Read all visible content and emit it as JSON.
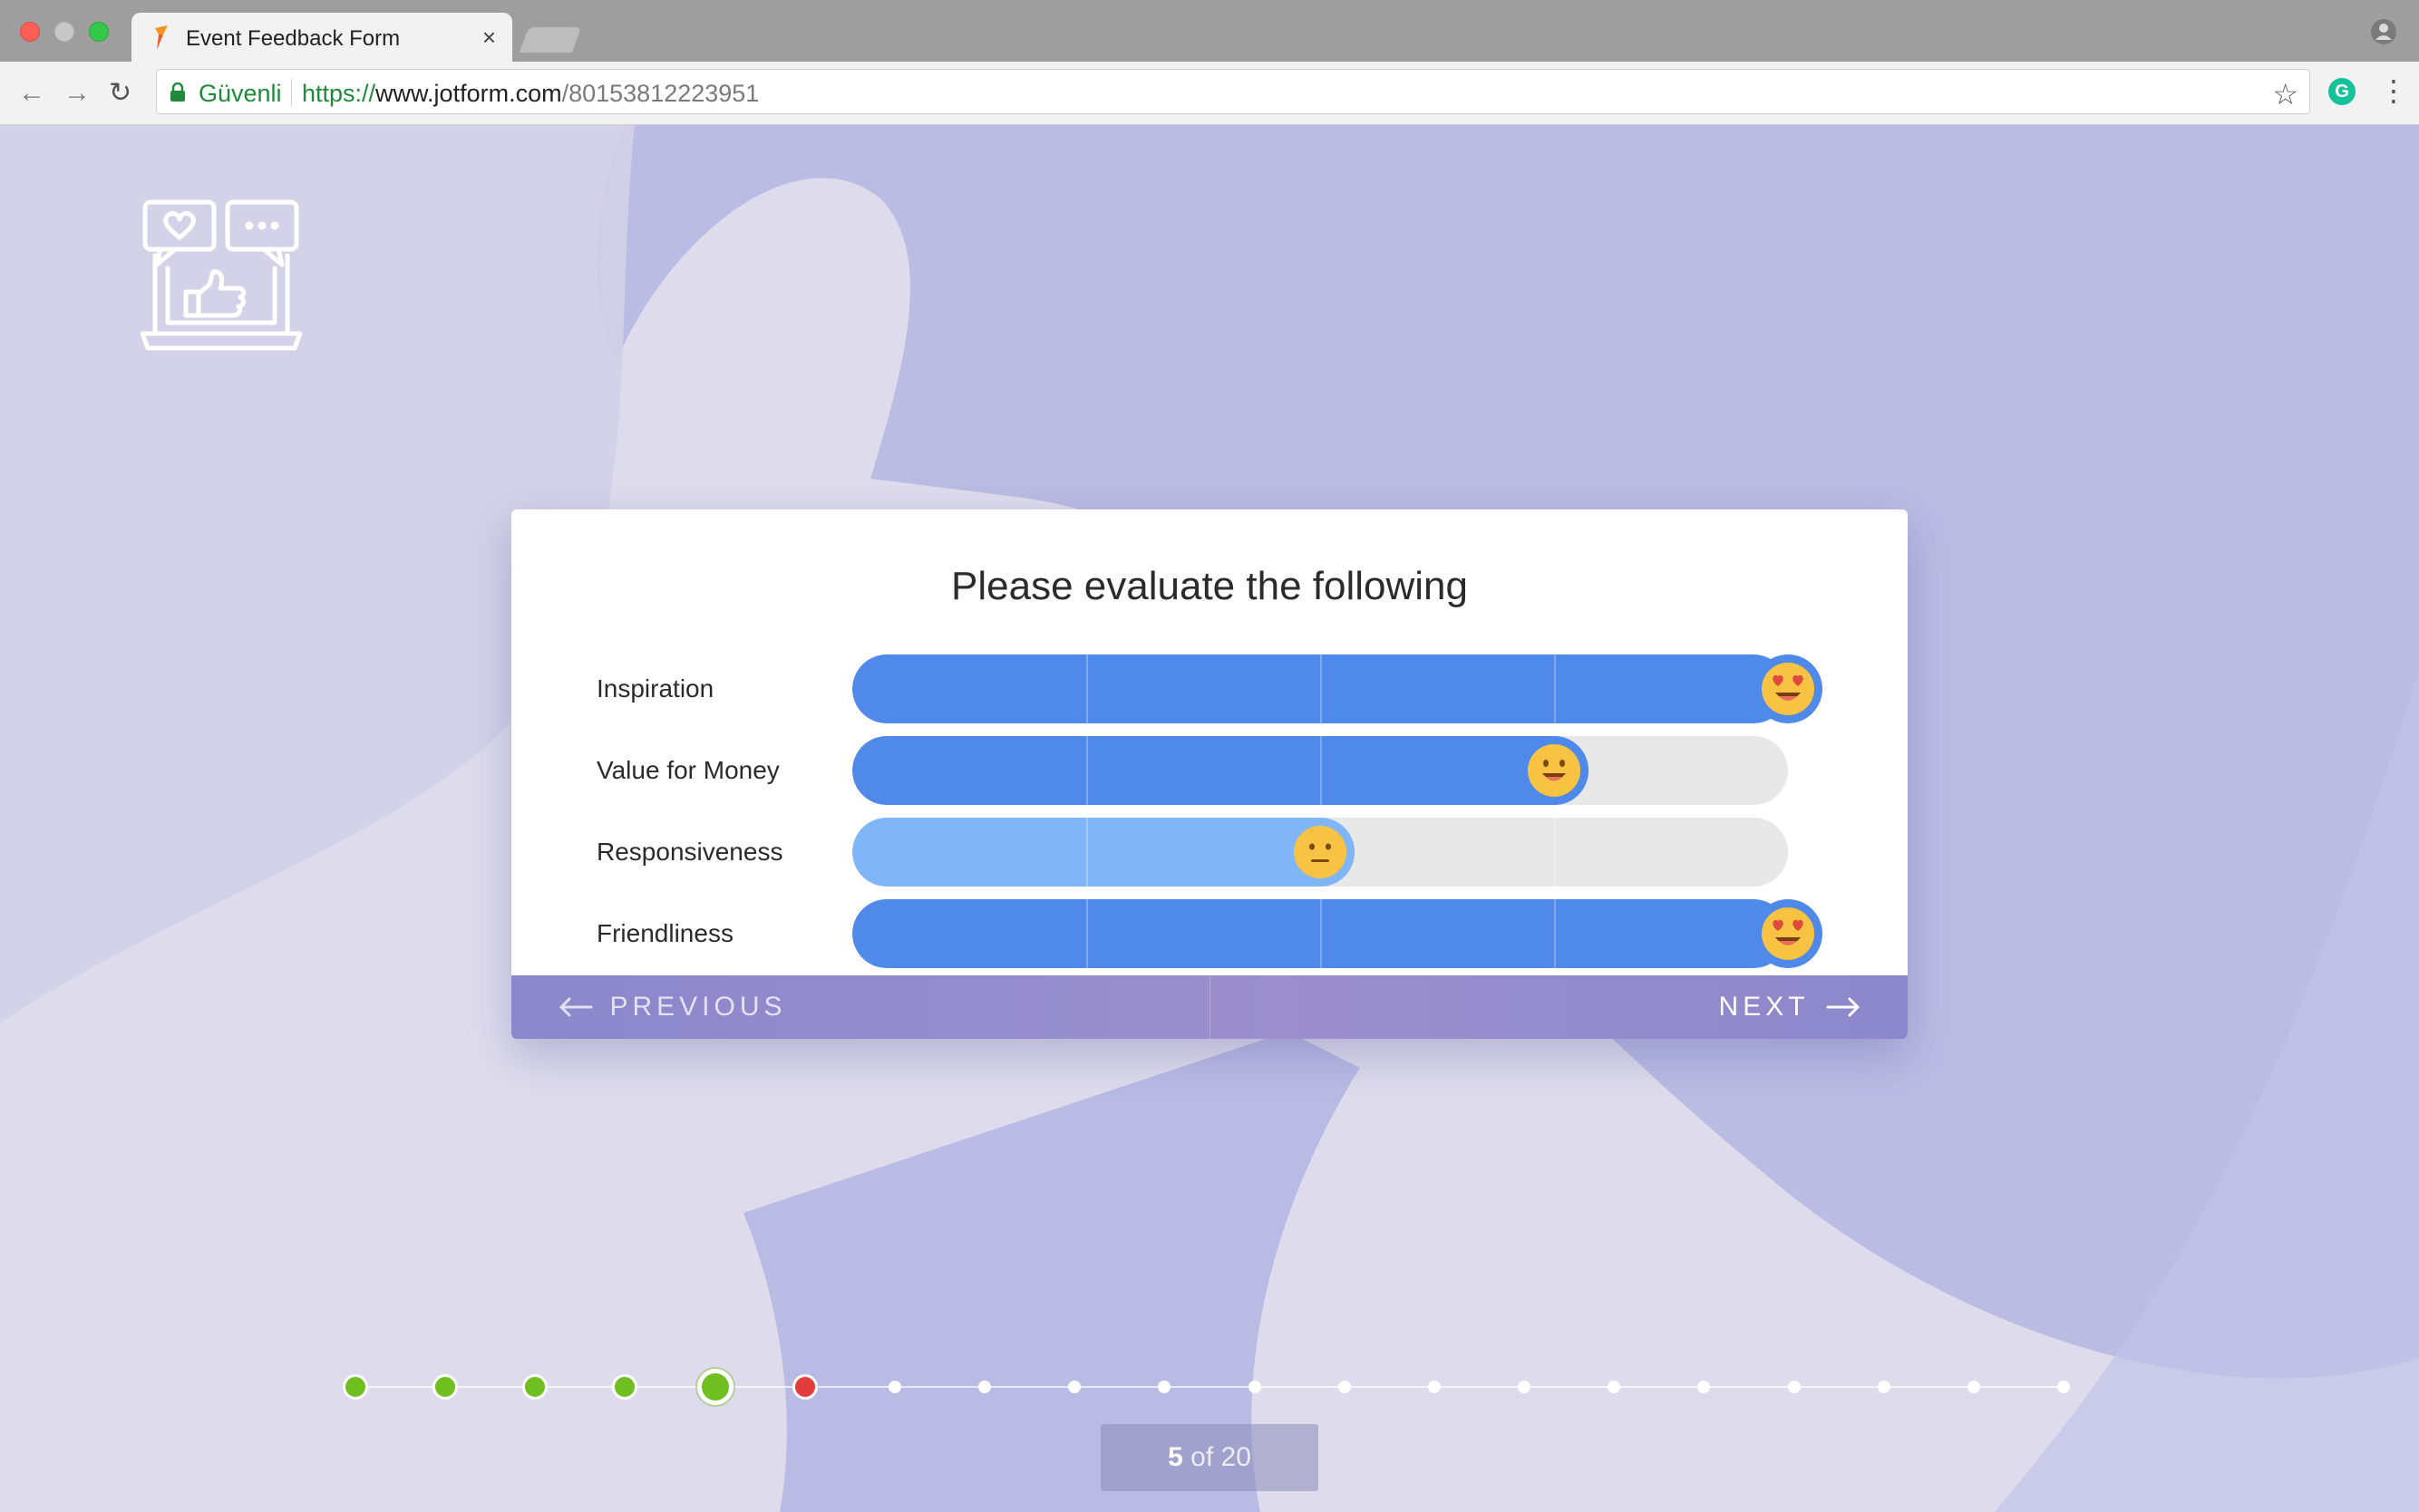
{
  "browser": {
    "tab_title": "Event Feedback Form",
    "tab_close": "×",
    "secure_label": "Güvenli",
    "url_scheme": "https://",
    "url_host": "www.jotform.com",
    "url_path": "/80153812223951"
  },
  "form": {
    "title": "Please evaluate the following",
    "rows": [
      {
        "label": "Inspiration",
        "level": 1.0,
        "emoji": "heart-eyes",
        "fill_color": "#4f89ea"
      },
      {
        "label": "Value for Money",
        "level": 0.75,
        "emoji": "grin",
        "fill_color": "#4f89ea"
      },
      {
        "label": "Responsiveness",
        "level": 0.5,
        "emoji": "neutral",
        "fill_color": "#80b5f7"
      },
      {
        "label": "Friendliness",
        "level": 1.0,
        "emoji": "heart-eyes",
        "fill_color": "#4f89ea"
      }
    ],
    "previous_label": "PREVIOUS",
    "next_label": "NEXT"
  },
  "progress": {
    "current": "5",
    "of_word": "of",
    "total": "20",
    "steps": [
      "done",
      "done",
      "done",
      "done",
      "current",
      "error",
      "todo",
      "todo",
      "todo",
      "todo",
      "todo",
      "todo",
      "todo",
      "todo",
      "todo",
      "todo",
      "todo",
      "todo",
      "todo",
      "todo"
    ]
  },
  "colors": {
    "accent": "#4f89ea",
    "footer": "#8b87cc",
    "done": "#6ebf1f",
    "error": "#e23c3c"
  }
}
